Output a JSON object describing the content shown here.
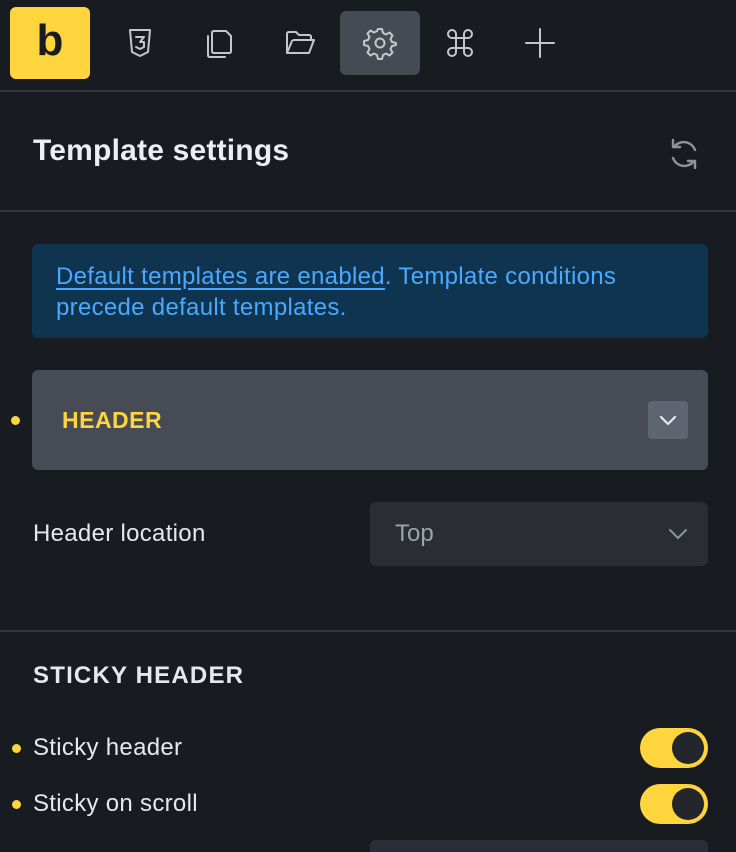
{
  "toolbar": {
    "logo_letter": "b",
    "buttons": [
      {
        "icon": "css3-icon"
      },
      {
        "icon": "pages-icon"
      },
      {
        "icon": "folder-open-icon"
      },
      {
        "icon": "gear-icon",
        "active": true
      },
      {
        "icon": "command-icon"
      },
      {
        "icon": "plus-icon"
      }
    ]
  },
  "panel": {
    "title": "Template settings",
    "refresh_icon": "refresh-icon"
  },
  "info": {
    "link_text": "Default templates are enabled",
    "rest_text": ". Template conditions precede default templates."
  },
  "header_group": {
    "title": "HEADER",
    "toggle_icon": "chevron-down-icon"
  },
  "header_location": {
    "label": "Header location",
    "value": "Top"
  },
  "sticky": {
    "section_title": "STICKY HEADER",
    "sticky_header_label": "Sticky header",
    "sticky_header_on": true,
    "sticky_scroll_label": "Sticky on scroll",
    "sticky_scroll_on": true
  },
  "colors": {
    "accent": "#ffd53e",
    "background": "#181b1f",
    "info_bg": "#0f3450",
    "info_text": "#4aa9ff"
  }
}
